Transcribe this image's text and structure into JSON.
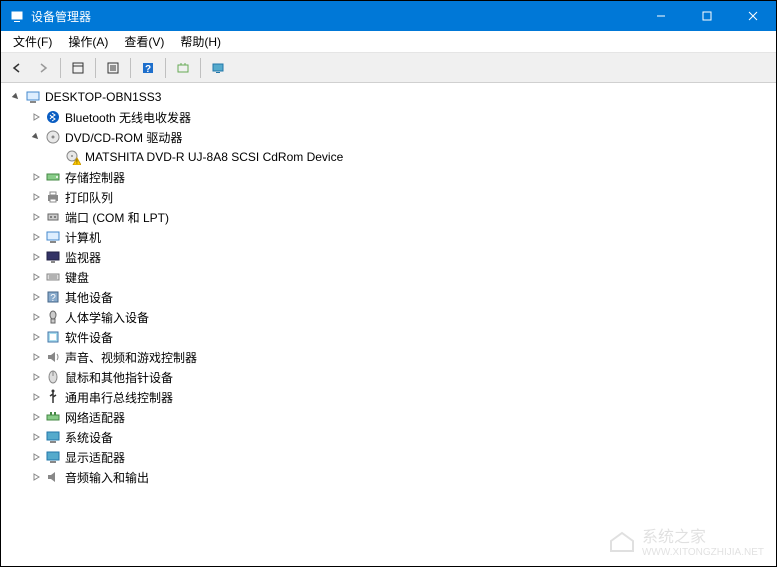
{
  "window": {
    "title": "设备管理器"
  },
  "menu": {
    "file": "文件(F)",
    "action": "操作(A)",
    "view": "查看(V)",
    "help": "帮助(H)"
  },
  "tree": {
    "root": "DESKTOP-OBN1SS3",
    "nodes": [
      {
        "label": "Bluetooth 无线电收发器",
        "icon": "bluetooth"
      },
      {
        "label": "DVD/CD-ROM 驱动器",
        "icon": "disc",
        "expanded": true,
        "children": [
          {
            "label": "MATSHITA DVD-R   UJ-8A8 SCSI CdRom Device",
            "icon": "disc-warn"
          }
        ]
      },
      {
        "label": "存储控制器",
        "icon": "storage"
      },
      {
        "label": "打印队列",
        "icon": "printer"
      },
      {
        "label": "端口 (COM 和 LPT)",
        "icon": "port"
      },
      {
        "label": "计算机",
        "icon": "computer"
      },
      {
        "label": "监视器",
        "icon": "monitor"
      },
      {
        "label": "键盘",
        "icon": "keyboard"
      },
      {
        "label": "其他设备",
        "icon": "other"
      },
      {
        "label": "人体学输入设备",
        "icon": "hid"
      },
      {
        "label": "软件设备",
        "icon": "software"
      },
      {
        "label": "声音、视频和游戏控制器",
        "icon": "sound"
      },
      {
        "label": "鼠标和其他指针设备",
        "icon": "mouse"
      },
      {
        "label": "通用串行总线控制器",
        "icon": "usb"
      },
      {
        "label": "网络适配器",
        "icon": "network"
      },
      {
        "label": "系统设备",
        "icon": "system"
      },
      {
        "label": "显示适配器",
        "icon": "display"
      },
      {
        "label": "音频输入和输出",
        "icon": "audio"
      }
    ]
  },
  "watermark": {
    "main": "系统之家",
    "sub": "WWW.XITONGZHIJIA.NET"
  }
}
